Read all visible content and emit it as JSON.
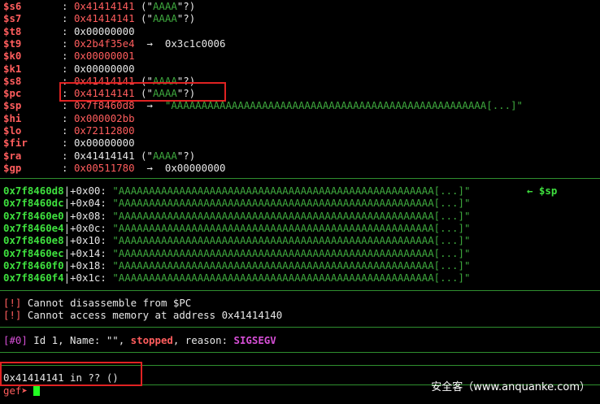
{
  "registers": [
    {
      "name": "$s6",
      "value": "0x41414141",
      "value_color": "red",
      "paren_open": " (\"",
      "ascii": "AAAA",
      "paren_close": "\"?)",
      "arrow": "",
      "target": ""
    },
    {
      "name": "$s7",
      "value": "0x41414141",
      "value_color": "red",
      "paren_open": " (\"",
      "ascii": "AAAA",
      "paren_close": "\"?)",
      "arrow": "",
      "target": ""
    },
    {
      "name": "$t8",
      "value": "0x00000000",
      "value_color": "white",
      "paren_open": "",
      "ascii": "",
      "paren_close": "",
      "arrow": "",
      "target": ""
    },
    {
      "name": "$t9",
      "value": "0x2b4f35e4",
      "value_color": "red",
      "paren_open": "",
      "ascii": "",
      "paren_close": "",
      "arrow": "  →  ",
      "target": "0x3c1c0006"
    },
    {
      "name": "$k0",
      "value": "0x00000001",
      "value_color": "red",
      "paren_open": "",
      "ascii": "",
      "paren_close": "",
      "arrow": "",
      "target": ""
    },
    {
      "name": "$k1",
      "value": "0x00000000",
      "value_color": "white",
      "paren_open": "",
      "ascii": "",
      "paren_close": "",
      "arrow": "",
      "target": ""
    },
    {
      "name": "$s8",
      "value": "0x41414141",
      "value_color": "red",
      "paren_open": " (\"",
      "ascii": "AAAA",
      "paren_close": "\"?)",
      "arrow": "",
      "target": ""
    },
    {
      "name": "$pc",
      "value": "0x41414141",
      "value_color": "red",
      "paren_open": " (\"",
      "ascii": "AAAA",
      "paren_close": "\"?)",
      "arrow": "",
      "target": ""
    },
    {
      "name": "$sp",
      "value": "0x7f8460d8",
      "value_color": "red",
      "paren_open": "",
      "ascii": "",
      "paren_close": "",
      "arrow": "  →  ",
      "target": "",
      "sp_string": "\"AAAAAAAAAAAAAAAAAAAAAAAAAAAAAAAAAAAAAAAAAAAAAAAAAAAA[...]\""
    },
    {
      "name": "$hi",
      "value": "0x000002bb",
      "value_color": "red",
      "paren_open": "",
      "ascii": "",
      "paren_close": "",
      "arrow": "",
      "target": ""
    },
    {
      "name": "$lo",
      "value": "0x72112800",
      "value_color": "red",
      "paren_open": "",
      "ascii": "",
      "paren_close": "",
      "arrow": "",
      "target": ""
    },
    {
      "name": "$fir",
      "value": "0x00000000",
      "value_color": "white",
      "paren_open": "",
      "ascii": "",
      "paren_close": "",
      "arrow": "",
      "target": ""
    },
    {
      "name": "$ra",
      "value": "0x41414141",
      "value_color": "white",
      "paren_open": " (\"",
      "ascii": "AAAA",
      "paren_close": "\"?)",
      "arrow": "",
      "target": ""
    },
    {
      "name": "$gp",
      "value": "0x00511780",
      "value_color": "red",
      "paren_open": "",
      "ascii": "",
      "paren_close": "",
      "arrow": "  →  ",
      "target": "0x00000000"
    }
  ],
  "stack": [
    {
      "addr": "0x7f8460d8",
      "offset": "+0x00:",
      "value": "\"AAAAAAAAAAAAAAAAAAAAAAAAAAAAAAAAAAAAAAAAAAAAAAAAAAAA[...]\"",
      "marker": "← $sp"
    },
    {
      "addr": "0x7f8460dc",
      "offset": "+0x04:",
      "value": "\"AAAAAAAAAAAAAAAAAAAAAAAAAAAAAAAAAAAAAAAAAAAAAAAAAAAA[...]\"",
      "marker": ""
    },
    {
      "addr": "0x7f8460e0",
      "offset": "+0x08:",
      "value": "\"AAAAAAAAAAAAAAAAAAAAAAAAAAAAAAAAAAAAAAAAAAAAAAAAAAAA[...]\"",
      "marker": ""
    },
    {
      "addr": "0x7f8460e4",
      "offset": "+0x0c:",
      "value": "\"AAAAAAAAAAAAAAAAAAAAAAAAAAAAAAAAAAAAAAAAAAAAAAAAAAAA[...]\"",
      "marker": ""
    },
    {
      "addr": "0x7f8460e8",
      "offset": "+0x10:",
      "value": "\"AAAAAAAAAAAAAAAAAAAAAAAAAAAAAAAAAAAAAAAAAAAAAAAAAAAA[...]\"",
      "marker": ""
    },
    {
      "addr": "0x7f8460ec",
      "offset": "+0x14:",
      "value": "\"AAAAAAAAAAAAAAAAAAAAAAAAAAAAAAAAAAAAAAAAAAAAAAAAAAAA[...]\"",
      "marker": ""
    },
    {
      "addr": "0x7f8460f0",
      "offset": "+0x18:",
      "value": "\"AAAAAAAAAAAAAAAAAAAAAAAAAAAAAAAAAAAAAAAAAAAAAAAAAAAA[...]\"",
      "marker": ""
    },
    {
      "addr": "0x7f8460f4",
      "offset": "+0x1c:",
      "value": "\"AAAAAAAAAAAAAAAAAAAAAAAAAAAAAAAAAAAAAAAAAAAAAAAAAAAA[...]\"",
      "marker": ""
    }
  ],
  "code": {
    "errors": [
      {
        "tag": "[!]",
        "text": " Cannot disassemble from $PC"
      },
      {
        "tag": "[!]",
        "text": " Cannot access memory at address 0x41414140"
      }
    ]
  },
  "threads": {
    "id_tag": "[#0]",
    "prefix": " Id 1, Name: \"\", ",
    "state": "stopped",
    "mid": ", reason: ",
    "reason": "SIGSEGV"
  },
  "trace": {
    "frame": "0x41414141 in ?? ()"
  },
  "prompt": {
    "text": "gef➤ "
  },
  "watermark": "安全客（www.anquanke.com）",
  "colors": {
    "background": "#000000",
    "register": "#ff5d5d",
    "ascii": "#3ea93e",
    "address": "#3ee03e",
    "highlight_box": "#e02222",
    "separator": "#2f8f2f",
    "signal": "#d64fd6"
  }
}
